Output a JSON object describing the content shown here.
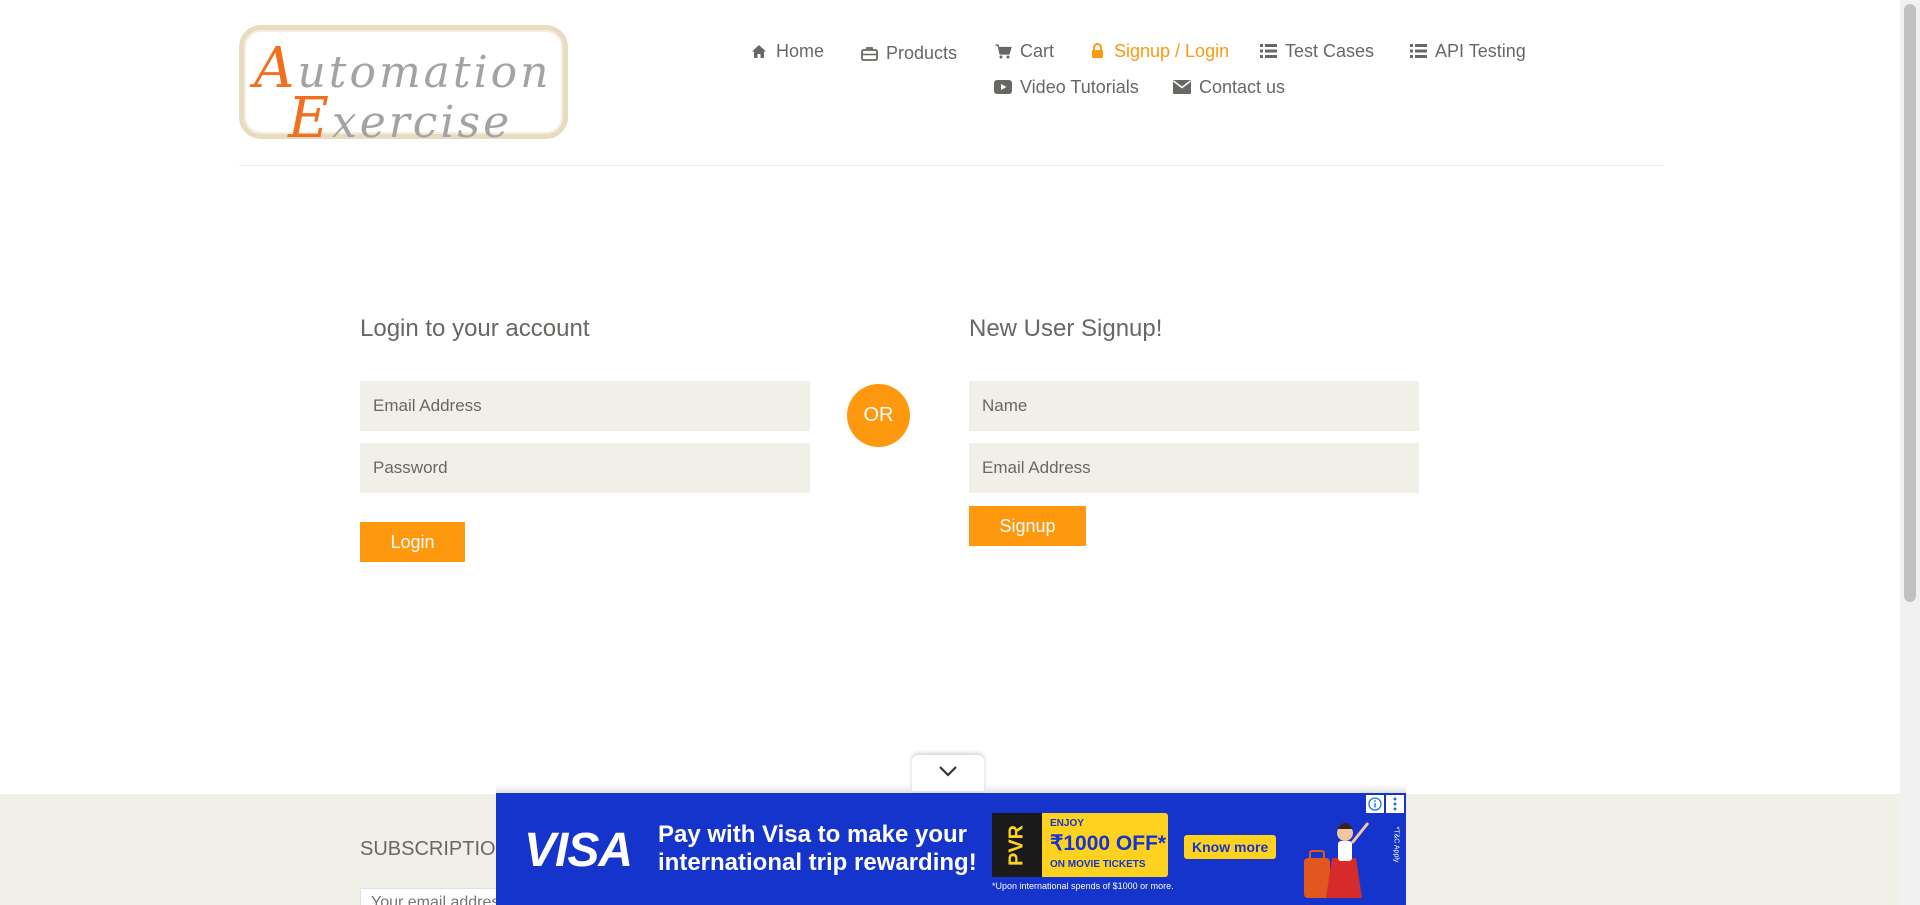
{
  "logo": {
    "line1_cap": "A",
    "line1_rest": "utomation",
    "line2_cap": "E",
    "line2_rest": "xercise"
  },
  "nav": {
    "items": [
      {
        "label": "Home",
        "icon": "home-icon"
      },
      {
        "label": "Products",
        "icon": "products-icon"
      },
      {
        "label": "Cart",
        "icon": "cart-icon"
      },
      {
        "label": "Signup / Login",
        "icon": "lock-icon",
        "active": true
      },
      {
        "label": "Test Cases",
        "icon": "list-icon"
      },
      {
        "label": "API Testing",
        "icon": "list-icon"
      },
      {
        "label": "Video Tutorials",
        "icon": "youtube-play-icon"
      },
      {
        "label": "Contact us",
        "icon": "envelope-icon"
      }
    ]
  },
  "login": {
    "title": "Login to your account",
    "email_placeholder": "Email Address",
    "email_value": "",
    "password_placeholder": "Password",
    "password_value": "",
    "button_label": "Login"
  },
  "or_label": "OR",
  "signup": {
    "title": "New User Signup!",
    "name_placeholder": "Name",
    "name_value": "",
    "email_placeholder": "Email Address",
    "email_value": "",
    "button_label": "Signup"
  },
  "footer": {
    "subscription_title": "SUBSCRIPTION",
    "subscription_placeholder": "Your email address"
  },
  "ad": {
    "brand": "VISA",
    "headline_line1": "Pay with Visa to make your",
    "headline_line2": "international trip rewarding!",
    "ticket_brand": "PVR",
    "ticket_enjoy": "ENJOY",
    "ticket_amount": "₹1000 OFF*",
    "ticket_movie": "ON MOVIE TICKETS",
    "fine_print": "*Upon international spends of $1000 or more.",
    "cta": "Know more",
    "tc": "*T&C Apply"
  },
  "colors": {
    "accent": "#fe980f",
    "text": "#696763",
    "field_bg": "#f0f0e9",
    "ad_blue": "#1434cb",
    "ad_yellow": "#ffd21f"
  }
}
